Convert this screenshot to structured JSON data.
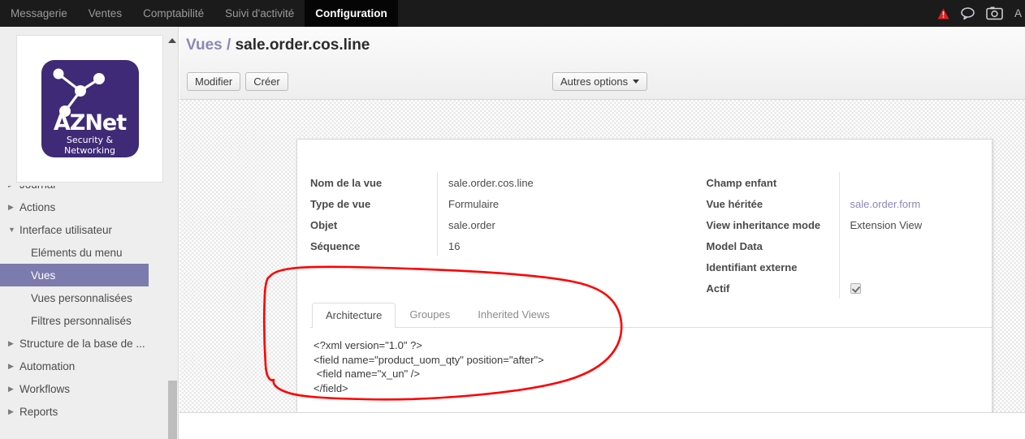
{
  "topnav": {
    "items": [
      {
        "label": "Messagerie",
        "active": false
      },
      {
        "label": "Ventes",
        "active": false
      },
      {
        "label": "Comptabilité",
        "active": false
      },
      {
        "label": "Suivi d'activité",
        "active": false
      },
      {
        "label": "Configuration",
        "active": true
      }
    ],
    "icons": [
      "warning-triangle-icon",
      "chat-bubble-icon",
      "camera-icon"
    ],
    "user": "A"
  },
  "sidebar": {
    "logo": {
      "name": "AZNet",
      "tagline": "Security & Networking",
      "color": "#3f2a78"
    },
    "items": [
      {
        "label": "Journal",
        "type": "group",
        "expanded": false,
        "clipped": true
      },
      {
        "label": "Actions",
        "type": "group",
        "expanded": false
      },
      {
        "label": "Interface utilisateur",
        "type": "group",
        "expanded": true
      },
      {
        "label": "Eléments du menu",
        "type": "child",
        "selected": false
      },
      {
        "label": "Vues",
        "type": "child",
        "selected": true
      },
      {
        "label": "Vues personnalisées",
        "type": "child",
        "selected": false
      },
      {
        "label": "Filtres personnalisés",
        "type": "child",
        "selected": false
      },
      {
        "label": "Structure de la base de ...",
        "type": "group",
        "expanded": false
      },
      {
        "label": "Automation",
        "type": "group",
        "expanded": false
      },
      {
        "label": "Workflows",
        "type": "group",
        "expanded": false
      },
      {
        "label": "Reports",
        "type": "group",
        "expanded": false
      }
    ]
  },
  "header": {
    "breadcrumb_root": "Vues",
    "breadcrumb_sep": "/",
    "breadcrumb_current": "sale.order.cos.line",
    "edit_label": "Modifier",
    "create_label": "Créer",
    "more_options_label": "Autres options"
  },
  "form": {
    "left": [
      {
        "label": "Nom de la vue",
        "value": "sale.order.cos.line",
        "kind": "text"
      },
      {
        "label": "Type de vue",
        "value": "Formulaire",
        "kind": "text"
      },
      {
        "label": "Objet",
        "value": "sale.order",
        "kind": "text"
      },
      {
        "label": "Séquence",
        "value": "16",
        "kind": "text"
      }
    ],
    "right": [
      {
        "label": "Champ enfant",
        "value": "",
        "kind": "text"
      },
      {
        "label": "Vue héritée",
        "value": "sale.order.form",
        "kind": "link"
      },
      {
        "label": "View inheritance mode",
        "value": "Extension View",
        "kind": "text"
      },
      {
        "label": "Model Data",
        "value": "",
        "kind": "text"
      },
      {
        "label": "Identifiant externe",
        "value": "",
        "kind": "text"
      },
      {
        "label": "Actif",
        "value": "",
        "kind": "checkbox",
        "checked": true
      }
    ]
  },
  "notebook": {
    "tabs": [
      {
        "label": "Architecture",
        "active": true
      },
      {
        "label": "Groupes",
        "active": false
      },
      {
        "label": "Inherited Views",
        "active": false
      }
    ],
    "architecture_code": "<?xml version=\"1.0\" ?>\n<field name=\"product_uom_qty\" position=\"after\">\n <field name=\"x_un\" />\n</field>"
  },
  "annotation": {
    "shape": "hand-drawn-ellipse",
    "color": "#ff0000"
  }
}
